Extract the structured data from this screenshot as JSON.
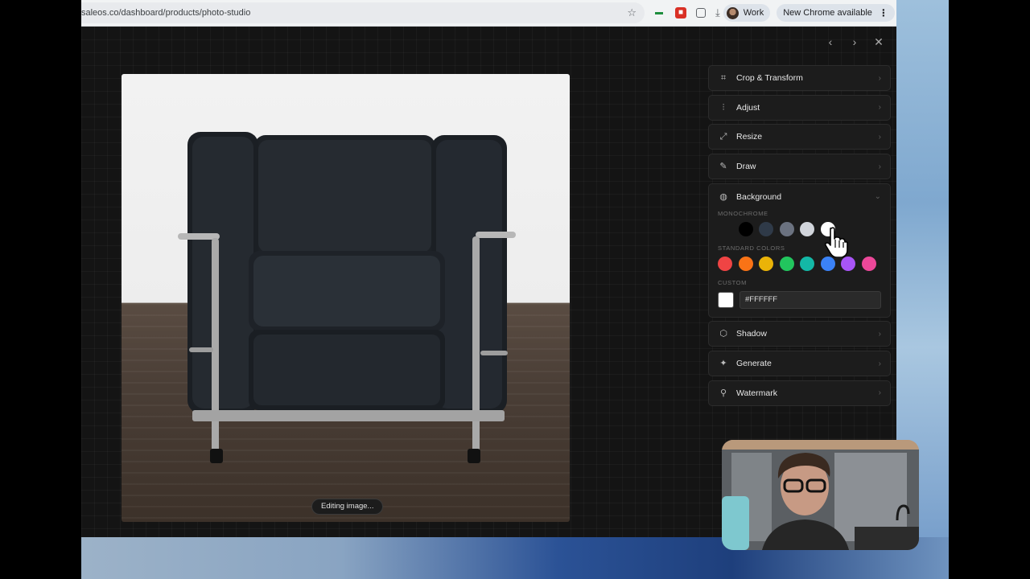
{
  "browser": {
    "url": "saleos.co/dashboard/products/photo-studio",
    "profile_label": "Work",
    "update_label": "New Chrome available"
  },
  "canvas": {
    "status_label": "Editing image..."
  },
  "panel": {
    "items_top": [
      {
        "label": "Crop & Transform",
        "icon": "crop-icon"
      },
      {
        "label": "Adjust",
        "icon": "sliders-icon"
      },
      {
        "label": "Resize",
        "icon": "resize-icon"
      },
      {
        "label": "Draw",
        "icon": "pencil-icon"
      }
    ],
    "background": {
      "label": "Background",
      "icon": "palette-icon",
      "monochrome_label": "MONOCHROME",
      "monochrome_colors": [
        "transparent",
        "#000000",
        "#2f3a48",
        "#6b7280",
        "#d1d5db",
        "#ffffff"
      ],
      "standard_label": "STANDARD COLORS",
      "standard_colors": [
        "#ef4444",
        "#f97316",
        "#eab308",
        "#22c55e",
        "#14b8a6",
        "#3b82f6",
        "#a855f7",
        "#ec4899"
      ],
      "custom_label": "CUSTOM",
      "custom_value": "#FFFFFF"
    },
    "items_bottom": [
      {
        "label": "Shadow",
        "icon": "cube-icon"
      },
      {
        "label": "Generate",
        "icon": "sparkles-icon"
      },
      {
        "label": "Watermark",
        "icon": "stamp-icon"
      }
    ]
  }
}
